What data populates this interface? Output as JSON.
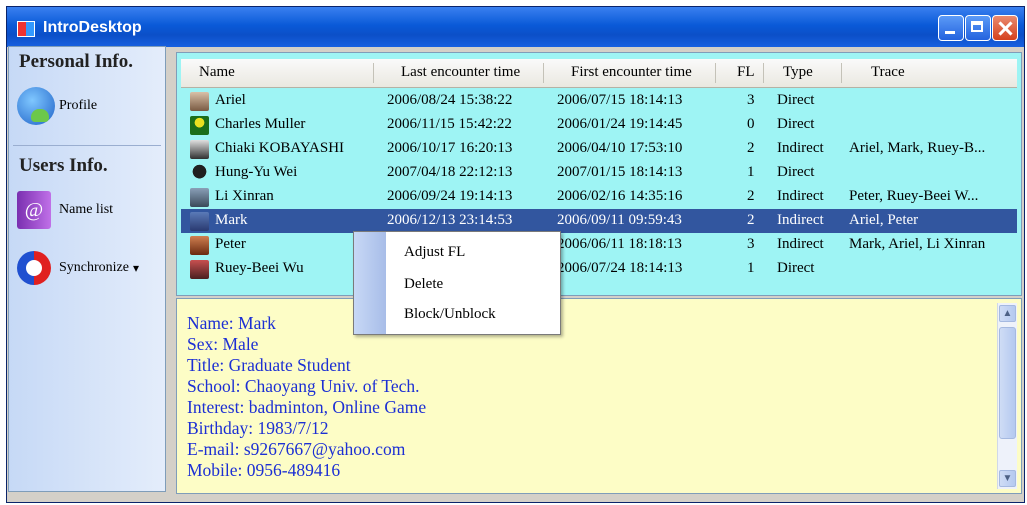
{
  "window": {
    "title": "IntroDesktop"
  },
  "sidebar": {
    "personal_header": "Personal Info.",
    "profile_label": "Profile",
    "users_header": "Users Info.",
    "namelist_label": "Name list",
    "sync_label": "Synchronize",
    "sync_arrow": "▾"
  },
  "table": {
    "columns": [
      "Name",
      "Last encounter time",
      "First encounter time",
      "FL",
      "Type",
      "Trace"
    ],
    "rows": [
      {
        "name": "Ariel",
        "last": "2006/08/24 15:38:22",
        "first": "2006/07/15 18:14:13",
        "fl": "3",
        "type": "Direct",
        "trace": ""
      },
      {
        "name": "Charles Muller",
        "last": "2006/11/15 15:42:22",
        "first": "2006/01/24 19:14:45",
        "fl": "0",
        "type": "Direct",
        "trace": ""
      },
      {
        "name": "Chiaki KOBAYASHI",
        "last": "2006/10/17 16:20:13",
        "first": "2006/04/10 17:53:10",
        "fl": "2",
        "type": "Indirect",
        "trace": "Ariel, Mark, Ruey-B..."
      },
      {
        "name": "Hung-Yu  Wei",
        "last": "2007/04/18 22:12:13",
        "first": "2007/01/15 18:14:13",
        "fl": "1",
        "type": "Direct",
        "trace": ""
      },
      {
        "name": "Li Xinran",
        "last": "2006/09/24 19:14:13",
        "first": "2006/02/16 14:35:16",
        "fl": "2",
        "type": "Indirect",
        "trace": "Peter, Ruey-Beei  W..."
      },
      {
        "name": "Mark",
        "last": "2006/12/13 23:14:53",
        "first": "2006/09/11 09:59:43",
        "fl": "2",
        "type": "Indirect",
        "trace": "Ariel, Peter"
      },
      {
        "name": "Peter",
        "last": "",
        "first": "2006/06/11 18:18:13",
        "fl": "3",
        "type": "Indirect",
        "trace": "Mark, Ariel, Li Xinran"
      },
      {
        "name": "Ruey-Beei  Wu",
        "last": "",
        "first": "2006/07/24 18:14:13",
        "fl": "1",
        "type": "Direct",
        "trace": ""
      }
    ],
    "selected_index": 5
  },
  "context_menu": {
    "items": [
      "Adjust FL",
      "Delete",
      "Block/Unblock"
    ]
  },
  "details": {
    "lines": [
      "Name: Mark",
      "Sex: Male",
      "Title: Graduate Student",
      "School: Chaoyang Univ. of Tech.",
      "Interest: badminton, Online Game",
      "Birthday: 1983/7/12",
      "E-mail: s9267667@yahoo.com",
      "Mobile: 0956-489416"
    ]
  },
  "colors": {
    "grid_bg": "#9ef4f4",
    "selected_row": "#32569f",
    "detail_bg": "#fdfdc6",
    "detail_text": "#1c2fd4"
  }
}
